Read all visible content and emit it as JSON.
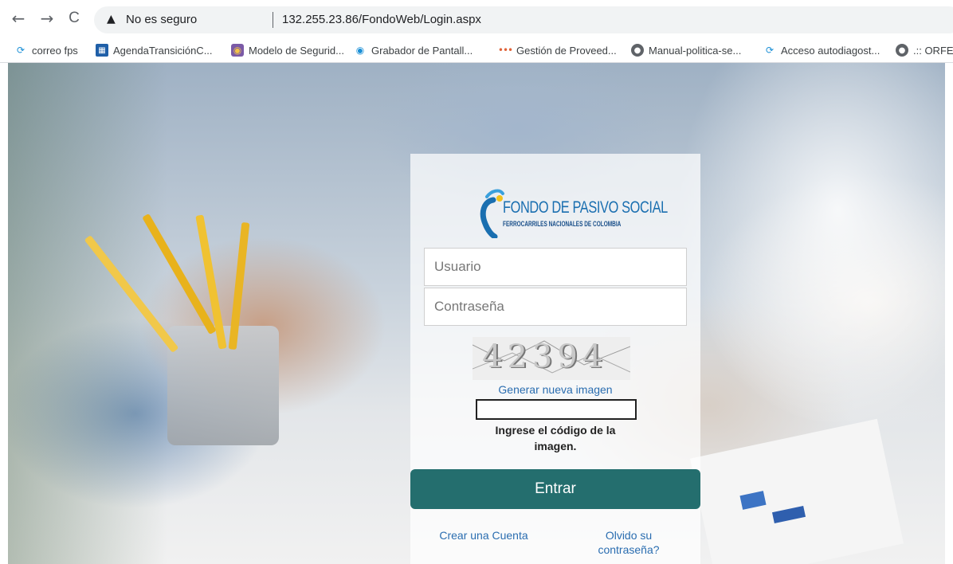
{
  "browser": {
    "nav": {
      "back_icon": "←",
      "forward_icon": "→",
      "reload_icon": "C"
    },
    "omnibox": {
      "warning_icon": "▲",
      "security_text": "No es seguro",
      "url": "132.255.23.86/FondoWeb/Login.aspx"
    },
    "bookmarks": [
      {
        "label": "correo fps",
        "icon": "fps-icon"
      },
      {
        "label": "AgendaTransiciónC...",
        "icon": "calendar-icon"
      },
      {
        "label": "Modelo de Segurid...",
        "icon": "owl-icon"
      },
      {
        "label": "Grabador de Pantall...",
        "icon": "recorder-icon"
      },
      {
        "label": "Gestión de Proveed...",
        "icon": "dots-icon"
      },
      {
        "label": "Manual-politica-se...",
        "icon": "globe-icon"
      },
      {
        "label": "Acceso autodiagost...",
        "icon": "fps-icon"
      },
      {
        "label": ".:: ORFE",
        "icon": "globe-icon"
      }
    ]
  },
  "login": {
    "logo_title": "FONDO DE PASIVO SOCIAL",
    "logo_subtitle": "FERROCARRILES NACIONALES DE COLOMBIA",
    "username_placeholder": "Usuario",
    "password_placeholder": "Contraseña",
    "captcha_text": "42394",
    "regenerate_label": "Generar nueva imagen",
    "code_label": "Ingrese el código de la imagen.",
    "submit_label": "Entrar",
    "create_account_label": "Crear una Cuenta",
    "forgot_password_label": "Olvido su contraseña?",
    "colors": {
      "button": "#246e6e",
      "link": "#2a6db0",
      "logo": "#1a6fb0"
    }
  }
}
